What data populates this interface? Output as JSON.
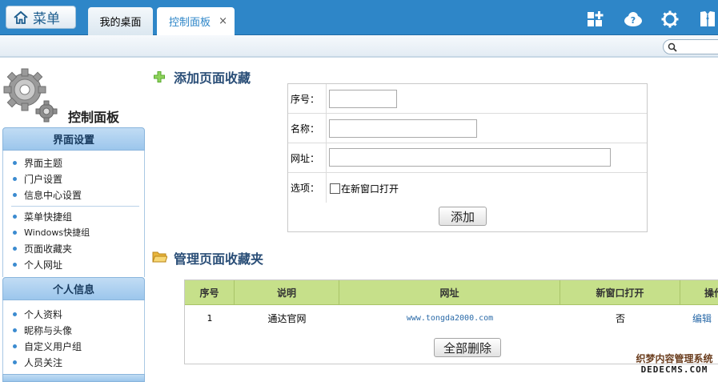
{
  "topbar": {
    "menu_label": "菜单",
    "tabs": [
      {
        "label": "我的桌面"
      },
      {
        "label": "控制面板",
        "close": "×"
      }
    ],
    "icons": [
      "add-tile-icon",
      "help-cloud-icon",
      "gear-icon",
      "user-icon"
    ]
  },
  "sidebar": {
    "title": "控制面板",
    "groups": [
      {
        "header": "界面设置",
        "items": [
          {
            "label": "界面主题"
          },
          {
            "label": "门户设置"
          },
          {
            "label": "信息中心设置"
          },
          {
            "label": "菜单快捷组"
          },
          {
            "label": "Windows快捷组"
          },
          {
            "label": "页面收藏夹"
          },
          {
            "label": "个人网址"
          }
        ]
      },
      {
        "header": "个人信息",
        "items": [
          {
            "label": "个人资料"
          },
          {
            "label": "昵称与头像"
          },
          {
            "label": "自定义用户组"
          },
          {
            "label": "人员关注"
          }
        ]
      }
    ]
  },
  "add_section": {
    "title": "添加页面收藏",
    "fields": [
      {
        "label": "序号：",
        "value": ""
      },
      {
        "label": "名称：",
        "value": ""
      },
      {
        "label": "网址：",
        "value": ""
      },
      {
        "label": "选项：",
        "checkbox_label": "在新窗口打开",
        "checked": false
      }
    ],
    "submit_label": "添加"
  },
  "manage_section": {
    "title": "管理页面收藏夹",
    "columns": [
      "序号",
      "说明",
      "网址",
      "新窗口打开",
      "操作"
    ],
    "rows": [
      {
        "index": "1",
        "desc": "通达官网",
        "url": "www.tongda2000.com",
        "new_window": "否",
        "action": "编辑"
      }
    ],
    "delete_all_label": "全部删除"
  },
  "watermark": {
    "line1": "织梦内容管理系统",
    "line2": "DEDECMS.COM"
  },
  "colors": {
    "topbar": "#2e86c8",
    "table_header": "#c6e08a",
    "link": "#2a6aa8"
  }
}
